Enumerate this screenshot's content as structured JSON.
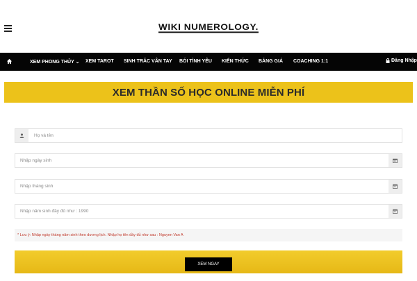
{
  "brand": {
    "logo_text": "WIKI NUMEROLOGY."
  },
  "nav": {
    "items": [
      {
        "label": "XEM PHONG THỦY ⌄"
      },
      {
        "label": "XEM TAROT"
      },
      {
        "label": "SINH TRẮC VÂN TAY"
      },
      {
        "label": "BÓI TÌNH YÊU"
      },
      {
        "label": "KIẾN THỨC"
      },
      {
        "label": "BẢNG GIÁ"
      },
      {
        "label": "COACHING 1:1"
      }
    ],
    "login_label": "Đăng Nhập"
  },
  "banner": {
    "title": "XEM THẦN SỐ HỌC ONLINE MIỄN PHÍ"
  },
  "form": {
    "name_placeholder": "Họ và tên",
    "day_placeholder": "Nhập ngày sinh",
    "month_placeholder": "Nhập tháng sinh",
    "year_placeholder": "Nhập năm sinh đầy đủ như : 1990",
    "note": "* Lưu ý: Nhập ngày tháng năm sinh theo dương lịch. Nhập họ tên đầy đủ như sau : Nguyen Van A",
    "submit_label": "XEM NGAY"
  },
  "colors": {
    "accent": "#ecc21a",
    "nav_bg": "#050505",
    "note_text": "#c0392b"
  },
  "icons": [
    "menu-icon",
    "home-icon",
    "lock-icon",
    "user-icon",
    "calendar-icon"
  ]
}
